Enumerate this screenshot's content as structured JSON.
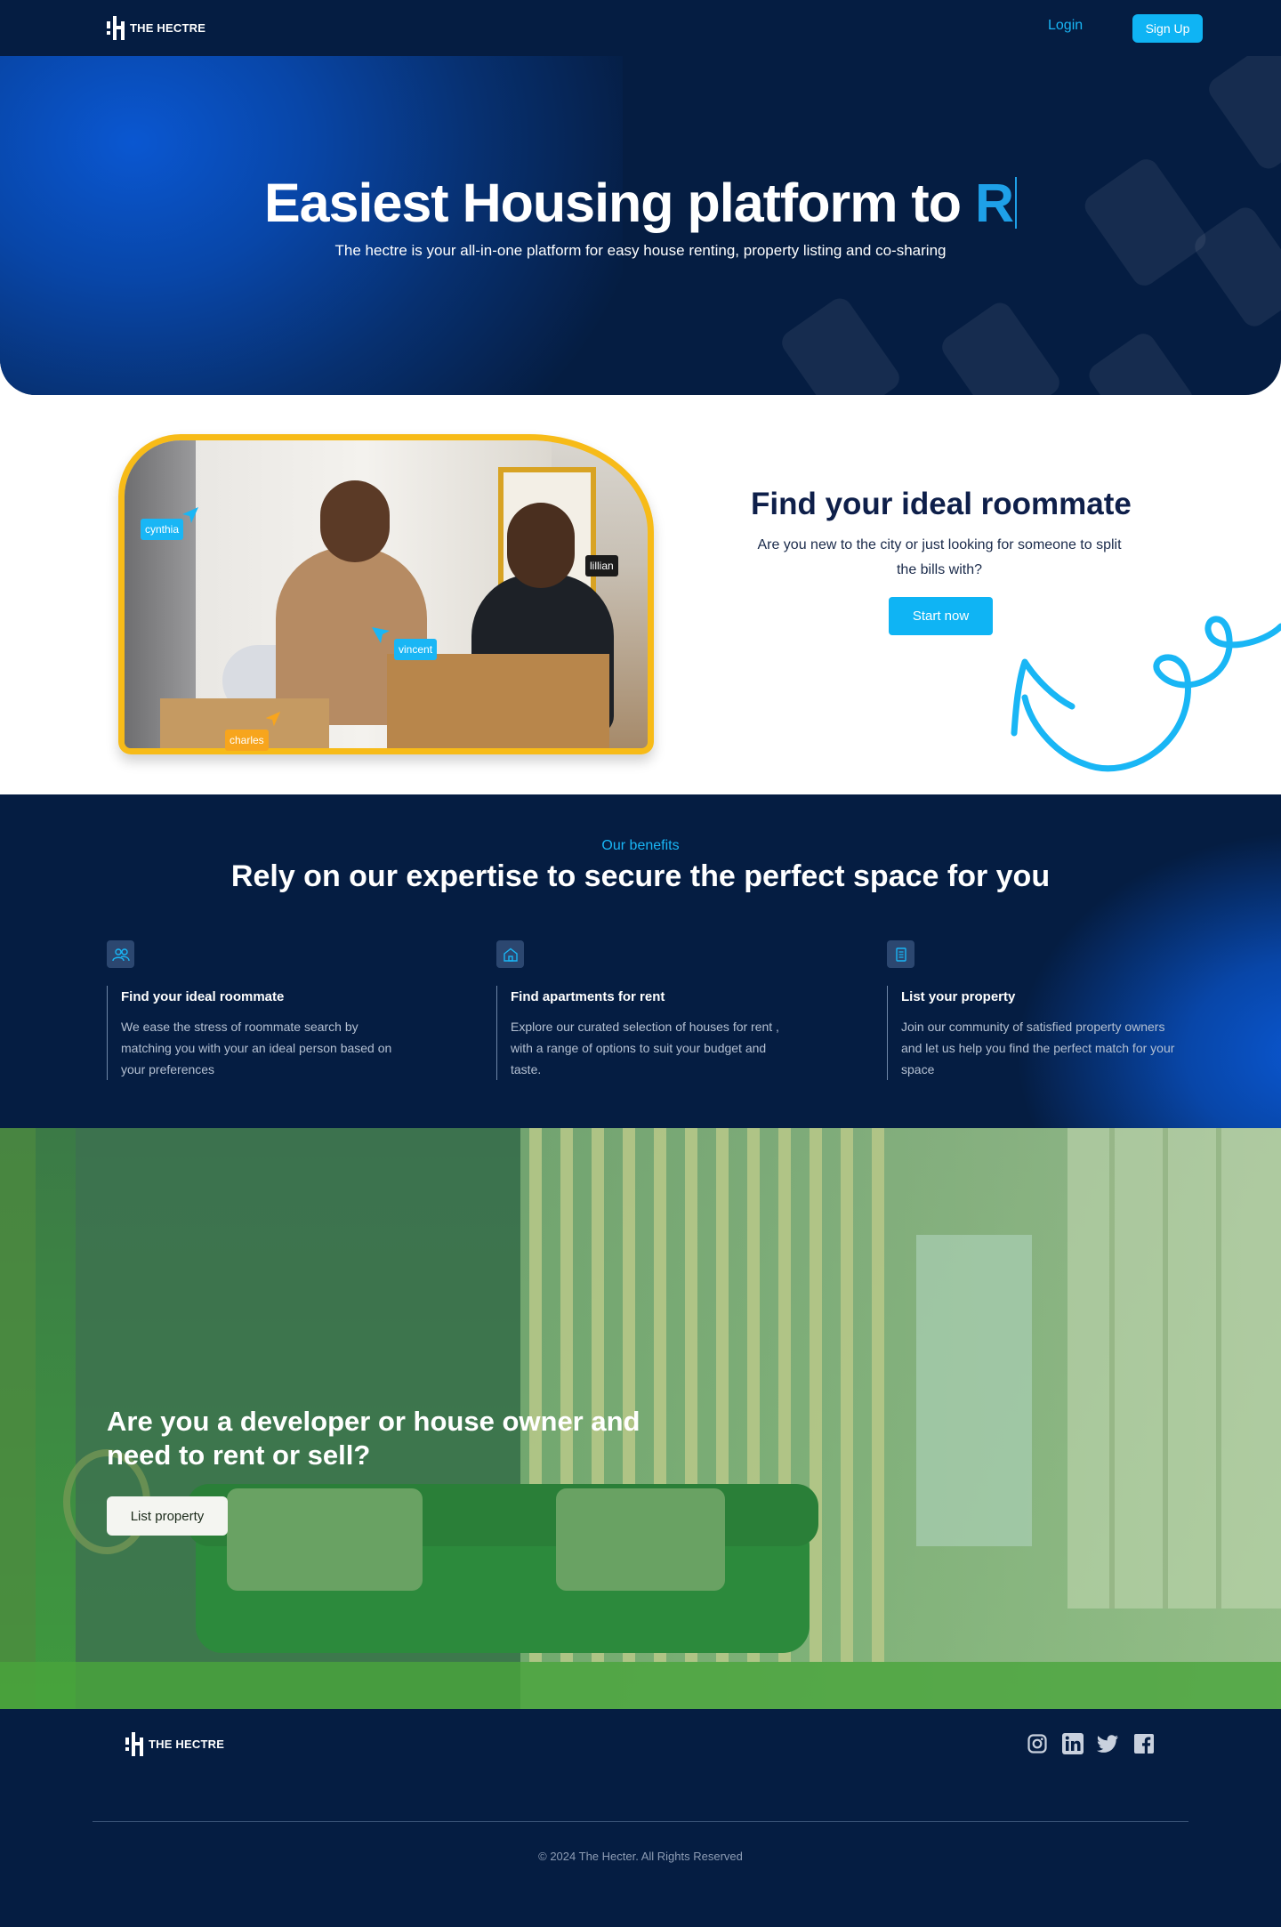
{
  "brand": {
    "name": "THE HECTRE"
  },
  "nav": {
    "login_label": "Login",
    "signup_label": "Sign Up"
  },
  "hero": {
    "title_prefix": "Easiest Housing platform to ",
    "title_typed": "R",
    "subtitle": "The hectre is your all-in-one platform for easy house renting, property listing and co-sharing"
  },
  "roommate": {
    "tags": [
      "cynthia",
      "lillian",
      "vincent",
      "charles"
    ],
    "title": "Find your ideal roommate",
    "text": "Are you new to the city or just looking for someone to split the bills with?",
    "button_label": "Start now"
  },
  "benefits": {
    "eyebrow": "Our benefits",
    "title": "Rely on our expertise to secure the perfect space for you",
    "items": [
      {
        "icon": "users-icon",
        "title": "Find your ideal roommate",
        "text": "We ease the stress of roommate search by matching you with your an ideal person based on your preferences"
      },
      {
        "icon": "home-icon",
        "title": "Find apartments for rent",
        "text": "Explore our curated selection of houses for rent , with a range of options to suit your budget and taste."
      },
      {
        "icon": "document-icon",
        "title": "List your property",
        "text": "Join our community of satisfied property owners and let us help you find the perfect match for your space"
      }
    ]
  },
  "cta": {
    "title": "Are you a developer or house owner and need to rent or sell?",
    "button_label": "List property"
  },
  "footer": {
    "socials": [
      "instagram-icon",
      "linkedin-icon",
      "twitter-icon",
      "facebook-icon"
    ],
    "copyright": "2024 The Hecter. All Rights Reserved"
  },
  "colors": {
    "navy": "#051d42",
    "accent": "#0fb4f4",
    "yellow": "#f7bb18",
    "green_overlay": "#3f8d42"
  }
}
